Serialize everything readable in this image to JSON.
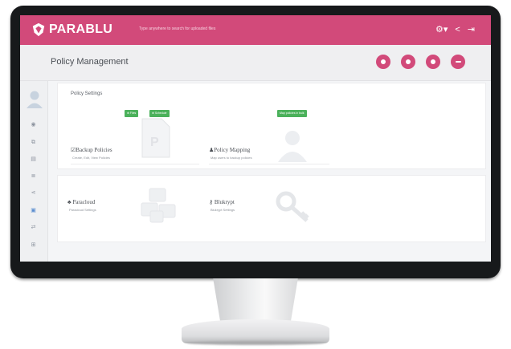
{
  "header": {
    "brand": "PARABLU",
    "search_placeholder": "Type anywhere to search for uploaded files"
  },
  "page": {
    "title": "Policy Management"
  },
  "policy_settings": {
    "section_label": "Policy Settings",
    "tags": [
      "Files",
      "Schedule"
    ],
    "activate_tag": "Map policies in bulk",
    "cards": [
      {
        "title": "Backup Policies",
        "subtitle": "Create, Edit, View Policies",
        "icon": "document-p-icon"
      },
      {
        "title": "Policy Mapping",
        "subtitle": "Map users to backup policies",
        "icon": "user-silhouette-icon"
      }
    ]
  },
  "other_settings": {
    "cards": [
      {
        "title": "Paracloud",
        "subtitle": "Paracloud Settings",
        "icon": "cubes-icon"
      },
      {
        "title": "Blukrypt",
        "subtitle": "Blukrypt Settings",
        "icon": "key-icon"
      }
    ]
  },
  "colors": {
    "brand": "#d24a7a",
    "tag_green": "#4bb15b",
    "bezel": "#17191b"
  }
}
